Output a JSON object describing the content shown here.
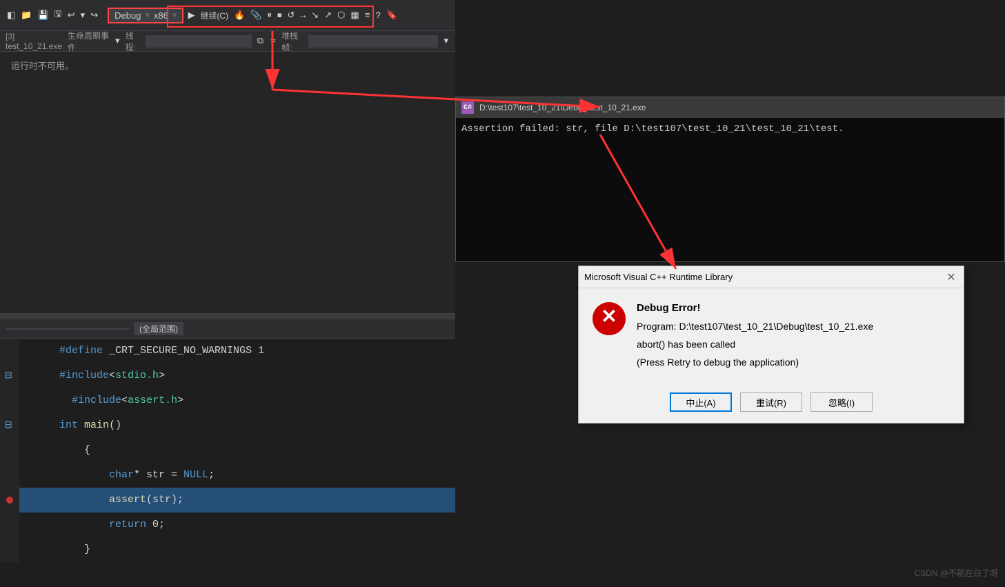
{
  "toolbar": {
    "debug_config": "Debug",
    "arch": "x86",
    "continue_label": "继续(C)",
    "process_label": "[3] test_10_21.exe",
    "lifecycle_label": "生命周期事件",
    "thread_label": "线程:",
    "callstack_label": "堆栈帧:",
    "scope_label": "(全局范围)"
  },
  "ide": {
    "not_available": "运行时不可用。"
  },
  "code": {
    "lines": [
      {
        "content": "#define _CRT_SECURE_NO_WARNINGS 1",
        "type": "plain",
        "gutter": ""
      },
      {
        "content": "#include<stdio.h>",
        "type": "include",
        "gutter": "minus"
      },
      {
        "content": "  #include<assert.h>",
        "type": "include",
        "gutter": ""
      },
      {
        "content": "int main()",
        "type": "fn",
        "gutter": "minus"
      },
      {
        "content": "  {",
        "type": "plain",
        "gutter": ""
      },
      {
        "content": "      char* str = NULL;",
        "type": "plain",
        "gutter": ""
      },
      {
        "content": "      assert(str);",
        "type": "assert",
        "gutter": "",
        "highlighted": true
      },
      {
        "content": "      return 0;",
        "type": "plain",
        "gutter": ""
      },
      {
        "content": "  }",
        "type": "plain",
        "gutter": ""
      }
    ]
  },
  "console": {
    "title": "D:\\test107\\test_10_21\\Debug\\test_10_21.exe",
    "icon_label": "C#",
    "message": "Assertion failed: str, file D:\\test107\\test_10_21\\test_10_21\\test."
  },
  "dialog": {
    "title": "Microsoft Visual C++ Runtime Library",
    "close_label": "✕",
    "error_label": "Debug Error!",
    "program_label": "Program: D:\\test107\\test_10_21\\Debug\\test_10_21.exe",
    "abort_label": "abort() has been called",
    "retry_hint": "(Press Retry to debug the application)",
    "btn_abort": "中止(A)",
    "btn_retry": "重试(R)",
    "btn_ignore": "忽略(I)"
  },
  "watermark": {
    "text": "CSDN @不能在白了呀"
  }
}
